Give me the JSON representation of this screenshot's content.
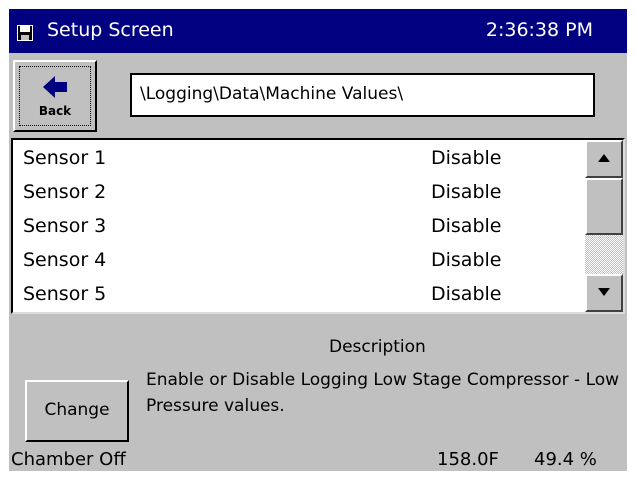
{
  "titlebar": {
    "icon": "floppy-disk-icon",
    "title": "Setup Screen",
    "time": "2:36:38 PM",
    "bg_color": "#000080"
  },
  "back_button": {
    "icon": "left-arrow-icon",
    "label": "Back"
  },
  "path": {
    "value": "\\Logging\\Data\\Machine Values\\"
  },
  "sensor_list": {
    "rows": [
      {
        "name": "Sensor 1",
        "status": "Disable"
      },
      {
        "name": "Sensor 2",
        "status": "Disable"
      },
      {
        "name": "Sensor 3",
        "status": "Disable"
      },
      {
        "name": "Sensor 4",
        "status": "Disable"
      },
      {
        "name": "Sensor 5",
        "status": "Disable"
      }
    ],
    "scrollbar": {
      "up_icon": "triangle-up-icon",
      "down_icon": "triangle-down-icon"
    }
  },
  "description": {
    "heading": "Description",
    "text": "Enable or Disable Logging Low Stage Compressor - Low Pressure values."
  },
  "change_button": {
    "label": "Change"
  },
  "status": {
    "chamber": "Chamber Off",
    "temperature": "158.0F",
    "humidity": "49.4 %"
  }
}
